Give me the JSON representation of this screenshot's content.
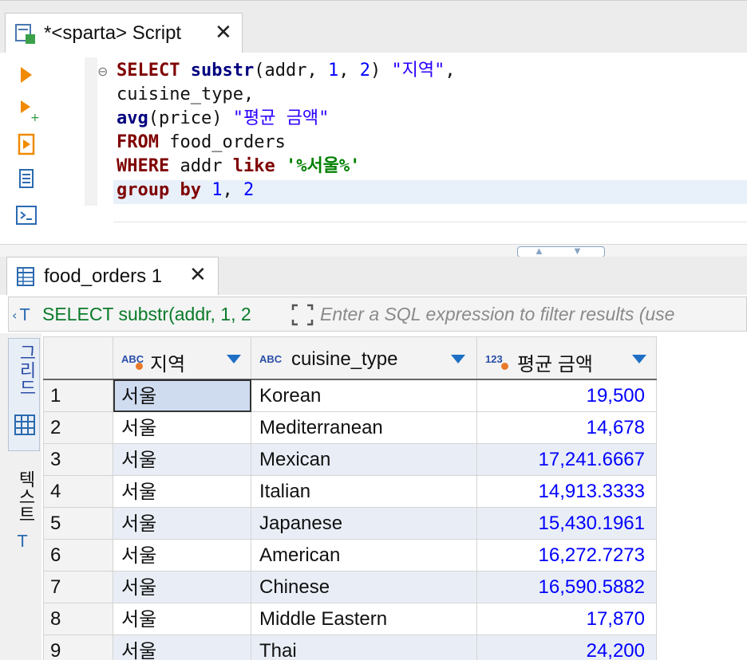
{
  "script_tab": {
    "title": "*<sparta> Script",
    "close": "✕"
  },
  "editor": {
    "lines": [
      {
        "t1": "SELECT",
        "t2": " ",
        "t3": "substr",
        "t4": "(addr, ",
        "t5": "1",
        "t6": ", ",
        "t7": "2",
        "t8": ") ",
        "t9": "\"지역\"",
        "t10": ","
      },
      {
        "text": "cuisine_type,"
      },
      {
        "fn": "avg",
        "rest": "(price) ",
        "str": "\"평균 금액\""
      },
      {
        "kw": "FROM",
        "rest": " food_orders"
      },
      {
        "kw": "WHERE",
        "mid": " addr ",
        "kw2": "like",
        "sp": " ",
        "str": "'%서울%'"
      },
      {
        "kw": "group by",
        "sp": " ",
        "n1": "1",
        "comma": ", ",
        "n2": "2"
      }
    ]
  },
  "results_tab": {
    "title": "food_orders 1",
    "close": "✕"
  },
  "filter": {
    "query": "SELECT substr(addr, 1, 2",
    "placeholder": "Enter a SQL expression to filter results (use"
  },
  "side_tabs": {
    "grid": "그리드",
    "text": "텍스트"
  },
  "grid": {
    "columns": [
      {
        "type": "ABC",
        "name": "지역"
      },
      {
        "type": "ABC",
        "name": "cuisine_type"
      },
      {
        "type": "123",
        "name": "평균 금액"
      }
    ],
    "rows": [
      {
        "n": "1",
        "region": "서울",
        "cuisine": "Korean",
        "avg": "19,500"
      },
      {
        "n": "2",
        "region": "서울",
        "cuisine": "Mediterranean",
        "avg": "14,678"
      },
      {
        "n": "3",
        "region": "서울",
        "cuisine": "Mexican",
        "avg": "17,241.6667"
      },
      {
        "n": "4",
        "region": "서울",
        "cuisine": "Italian",
        "avg": "14,913.3333"
      },
      {
        "n": "5",
        "region": "서울",
        "cuisine": "Japanese",
        "avg": "15,430.1961"
      },
      {
        "n": "6",
        "region": "서울",
        "cuisine": "American",
        "avg": "16,272.7273"
      },
      {
        "n": "7",
        "region": "서울",
        "cuisine": "Chinese",
        "avg": "16,590.5882"
      },
      {
        "n": "8",
        "region": "서울",
        "cuisine": "Middle Eastern",
        "avg": "17,870"
      },
      {
        "n": "9",
        "region": "서울",
        "cuisine": "Thai",
        "avg": "24,200"
      }
    ]
  }
}
